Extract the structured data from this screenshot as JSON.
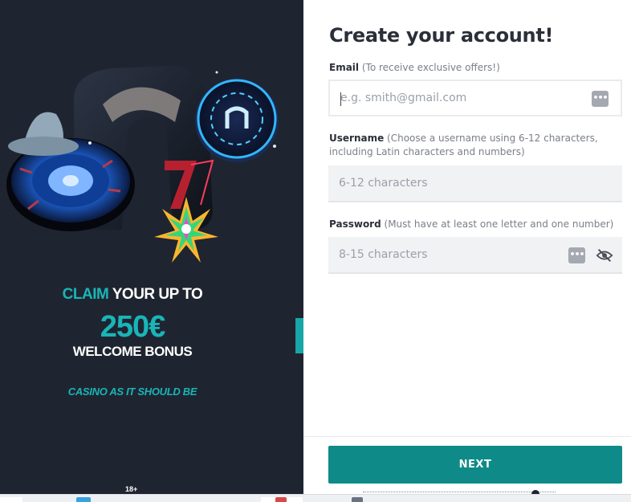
{
  "promo": {
    "claim": "CLAIM",
    "claim_rest": " YOUR UP TO",
    "amount": "250€",
    "bonus": "WELCOME BONUS",
    "tagline": "CASINO AS IT SHOULD BE",
    "age": "18+",
    "colors": {
      "background": "#1f2530",
      "accent": "#19b5b8"
    },
    "art": "casino-collage-roulette-chip-slot-gem-icon"
  },
  "form": {
    "title": "Create your account!",
    "email": {
      "label": "Email",
      "hint": " (To receive exclusive offers!)",
      "placeholder": "e.g. smith@gmail.com",
      "value": "",
      "icon": "password-manager-icon"
    },
    "username": {
      "label": "Username",
      "hint": " (Choose a username using 6-12 characters, including Latin characters and numbers)",
      "placeholder": "6-12 characters",
      "value": ""
    },
    "password": {
      "label": "Password",
      "hint": " (Must have at least one letter and one number)",
      "placeholder": "8-15 characters",
      "value": "",
      "icons": [
        "password-manager-icon",
        "eye-slash-icon"
      ]
    },
    "next_label": "NEXT",
    "colors": {
      "primary": "#0e8a89",
      "text": "#2a2f38",
      "hint": "#7a7f88"
    }
  }
}
